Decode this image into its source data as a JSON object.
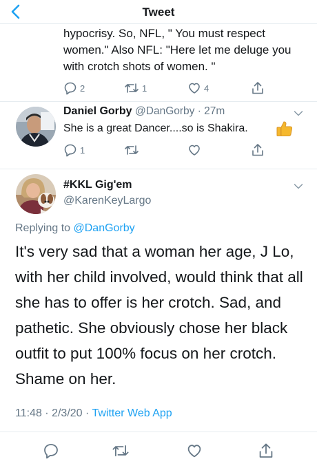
{
  "header": {
    "title": "Tweet",
    "back_icon": "chevron-left-icon"
  },
  "colors": {
    "accent": "#1da1f2",
    "muted": "#657786",
    "text": "#14171a",
    "divider": "#e6ecf0"
  },
  "tweet1": {
    "text": "hypocrisy.  So, NFL, \" You must respect women.\"  Also NFL:  \"Here let me deluge you with crotch shots of women. \"",
    "reply_count": "2",
    "retweet_count": "1",
    "like_count": "4"
  },
  "tweet2": {
    "name": "Daniel Gorby",
    "handle_time": "@DanGorby · 27m",
    "text": "She is a great Dancer....so is Shakira.",
    "emoji": "thumbs-up-icon",
    "reply_count": "1"
  },
  "tweet3": {
    "name": "#KKL Gig'em",
    "handle": "@KarenKeyLargo",
    "replying_prefix": "Replying to ",
    "replying_to": "@DanGorby",
    "text": "It's very sad that a woman her age, J Lo, with her child involved, would think that all she has to offer is her crotch. Sad, and pathetic.  She obviously chose her black outfit to put 100% focus on her crotch.  Shame on her.",
    "timestamp": "11:48 · 2/3/20 · ",
    "source": "Twitter Web App"
  }
}
